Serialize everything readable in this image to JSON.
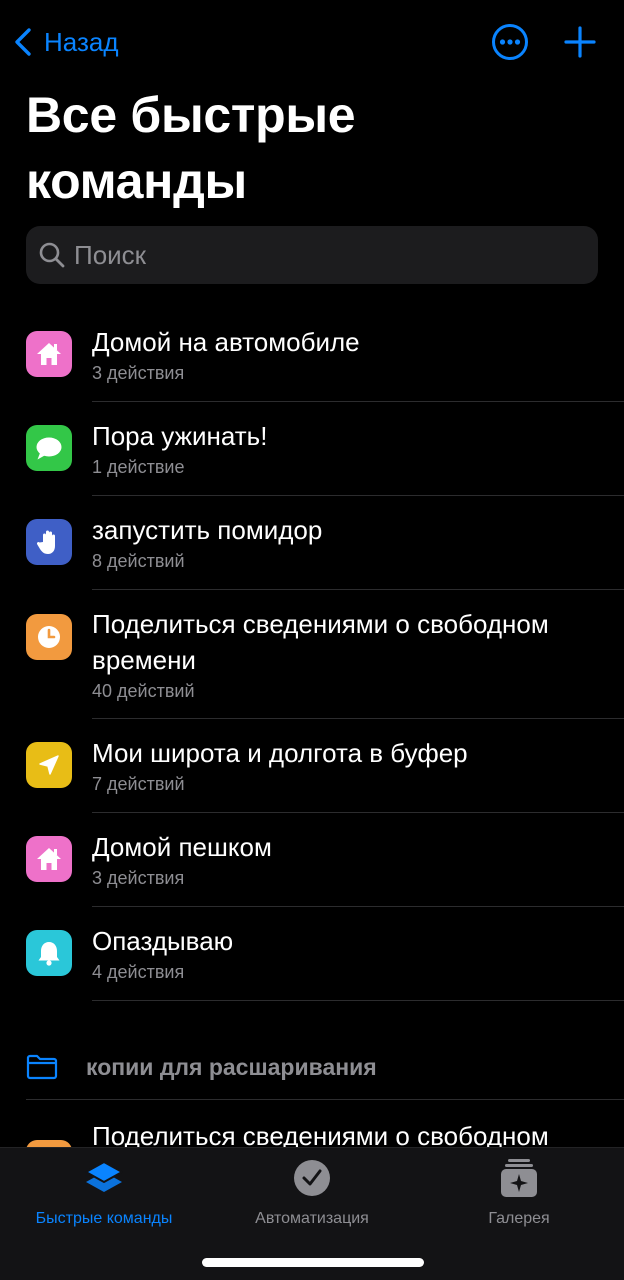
{
  "nav": {
    "back_label": "Назад"
  },
  "title": "Все быстрые команды",
  "search": {
    "placeholder": "Поиск"
  },
  "shortcuts": [
    {
      "name": "Домой на автомобиле",
      "subtitle": "3 действия",
      "icon": "house-icon",
      "color": "#ee71c9"
    },
    {
      "name": "Пора ужинать!",
      "subtitle": "1 действие",
      "icon": "message-bubble-icon",
      "color": "#33c748"
    },
    {
      "name": "запустить помидор",
      "subtitle": "8 действий",
      "icon": "hand-icon",
      "color": "#3f5fc6"
    },
    {
      "name": "Поделиться сведениями о свободном времени",
      "subtitle": "40 действий",
      "icon": "clock-icon",
      "color": "#f29a3f"
    },
    {
      "name": "Мои широта и долгота в буфер",
      "subtitle": "7 действий",
      "icon": "location-arrow-icon",
      "color": "#e8bd16"
    },
    {
      "name": "Домой пешком",
      "subtitle": "3 действия",
      "icon": "house-icon",
      "color": "#ee71c9"
    },
    {
      "name": "Опаздываю",
      "subtitle": "4 действия",
      "icon": "bell-icon",
      "color": "#2ac7d9"
    }
  ],
  "folder": {
    "label": "копии для расшаривания",
    "partial_item": "Поделиться сведениями о свободном"
  },
  "tabbar": {
    "shortcuts_label": "Быстрые команды",
    "automation_label": "Автоматизация",
    "gallery_label": "Галерея"
  },
  "colors": {
    "accent": "#0a84ff",
    "background": "#000000",
    "secondary_text": "#8e8e93"
  }
}
